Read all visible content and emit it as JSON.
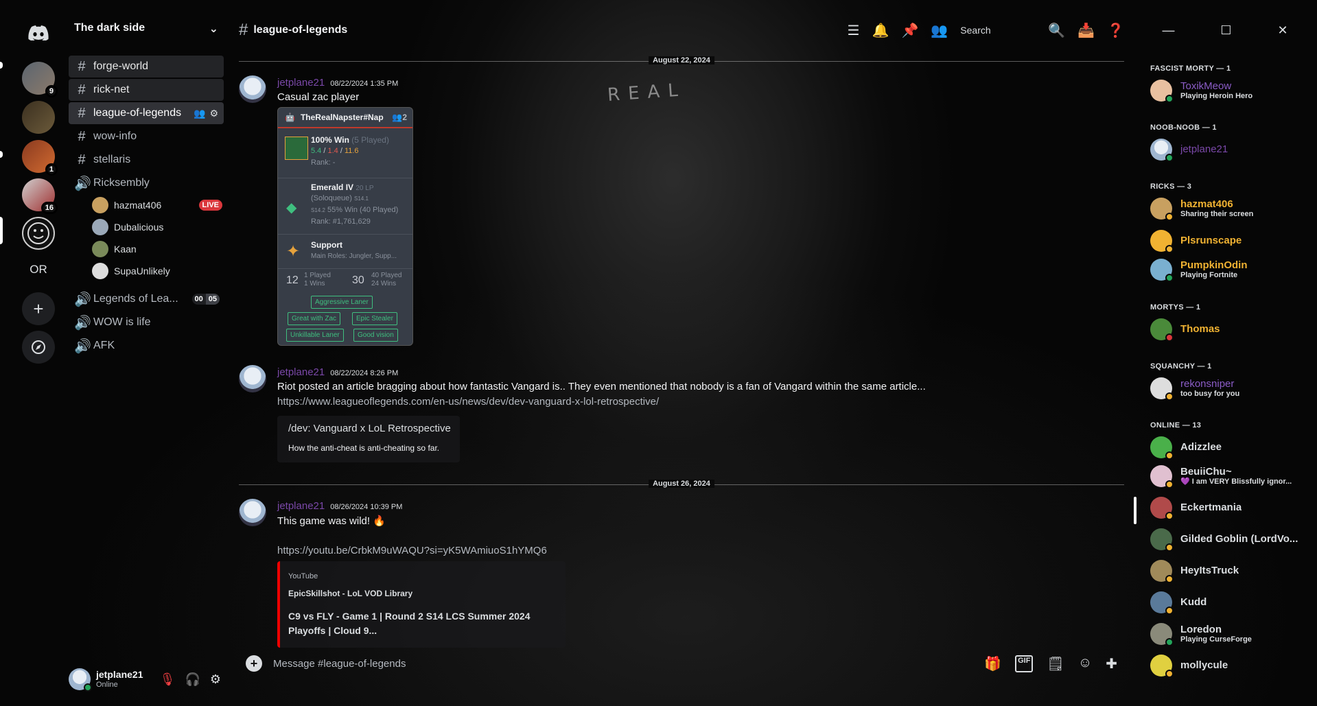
{
  "server": {
    "name": "The dark side",
    "rail_label": "OR",
    "badges": [
      "9",
      "1",
      "16"
    ]
  },
  "channels": [
    {
      "name": "forge-world",
      "type": "text"
    },
    {
      "name": "rick-net",
      "type": "text"
    },
    {
      "name": "league-of-legends",
      "type": "text"
    },
    {
      "name": "wow-info",
      "type": "text"
    },
    {
      "name": "stellaris",
      "type": "text"
    },
    {
      "name": "Ricksembly",
      "type": "voice"
    },
    {
      "name": "Legends of Lea...",
      "type": "voice"
    },
    {
      "name": "WOW is life",
      "type": "voice"
    },
    {
      "name": "AFK",
      "type": "voice"
    }
  ],
  "voice_users": [
    {
      "name": "hazmat406",
      "badge": "LIVE"
    },
    {
      "name": "Dubalicious"
    },
    {
      "name": "Kaan"
    },
    {
      "name": "SupaUnlikely"
    }
  ],
  "voice_count": [
    "00",
    "05"
  ],
  "user_panel": {
    "name": "jetplane21",
    "status": "Online"
  },
  "header": {
    "channel": "league-of-legends",
    "search_placeholder": "Search"
  },
  "composer": {
    "placeholder": "Message #league-of-legends"
  },
  "dates": [
    "August 22, 2024",
    "August 26, 2024"
  ],
  "messages": [
    {
      "author": "jetplane21",
      "time": "08/22/2024 1:35 PM",
      "text": "Casual zac player"
    },
    {
      "author": "jetplane21",
      "time": "08/22/2024 8:26 PM",
      "text": "Riot posted an article bragging about how fantastic Vangard is.. They even mentioned that nobody is a fan of Vangard within the same article...",
      "link": "https://www.leagueoflegends.com/en-us/news/dev/dev-vanguard-x-lol-retrospective/"
    },
    {
      "author": "jetplane21",
      "time": "08/26/2024 10:39 PM",
      "text": "This game was wild! 🔥",
      "link": "https://youtu.be/CrbkM9uWAQU?si=yK5WAmiuoS1hYMQ6"
    }
  ],
  "lol_card": {
    "title": "TheRealNapster#Nap",
    "count": "2",
    "win": "100% Win",
    "played": "(5 Played)",
    "kda_k": "5.4",
    "kda_d": "1.4",
    "kda_a": "11.6",
    "rank_label": "Rank: -",
    "tier": "Emerald IV",
    "lp": "20 LP",
    "queue": "(Soloqueue)",
    "season_tag": "S14.1",
    "season_prev": "S14.2",
    "season_win": "55% Win (40 Played)",
    "ladder": "Rank: #1,761,629",
    "role": "Support",
    "main_roles": "Main Roles: Jungler, Supp...",
    "lvl1": "12",
    "lvl1_played": "1 Played",
    "lvl1_wins": "1 Wins",
    "lvl2": "30",
    "lvl2_played": "40 Played",
    "lvl2_wins": "24 Wins",
    "tags": [
      "Aggressive Laner",
      "Great with Zac",
      "Epic Stealer",
      "Unkillable Laner",
      "Good vision"
    ]
  },
  "article_embed": {
    "title": "/dev: Vanguard x LoL Retrospective",
    "desc": "How the anti-cheat is anti-cheating so far."
  },
  "yt_embed": {
    "provider": "YouTube",
    "author": "EpicSkillshot - LoL VOD Library",
    "title_line1": "C9 vs FLY - Game 1 | Round 2 S14 LCS Summer 2024",
    "title_line2": "Playoffs | Cloud 9..."
  },
  "members": {
    "groups": [
      {
        "label": "FASCIST MORTY — 1",
        "members": [
          {
            "name": "ToxikMeow",
            "sub": "Playing Heroin Hero",
            "color": "#8b5cc7",
            "dot": "#23a55a"
          }
        ]
      },
      {
        "label": "NOOB-NOOB — 1",
        "members": [
          {
            "name": "jetplane21",
            "sub": "",
            "color": "#7a48a8",
            "dot": "#23a55a"
          }
        ]
      },
      {
        "label": "RICKS — 3",
        "members": [
          {
            "name": "hazmat406",
            "sub": "Sharing their screen",
            "color": "#f0b232",
            "dot": "#f0b232"
          },
          {
            "name": "Plsrunscape",
            "sub": "",
            "color": "#f0b232",
            "dot": "#f0b232"
          },
          {
            "name": "PumpkinOdin",
            "sub": "Playing Fortnite",
            "color": "#f0b232",
            "dot": "#23a55a"
          }
        ]
      },
      {
        "label": "MORTYS — 1",
        "members": [
          {
            "name": "Thomas",
            "sub": "",
            "color": "#f0b232",
            "dot": "#da373c"
          }
        ]
      },
      {
        "label": "SQUANCHY — 1",
        "members": [
          {
            "name": "rekonsniper",
            "sub": "too busy for you",
            "color": "#8b5cc7",
            "dot": "#f0b232"
          }
        ]
      },
      {
        "label": "ONLINE — 13",
        "members": [
          {
            "name": "Adizzlee",
            "sub": "",
            "color": "#f2f3f5",
            "dot": "#f0b232"
          },
          {
            "name": "BeuiiChu~",
            "sub": "💜 I am VERY Blissfully ignor...",
            "color": "#f2f3f5",
            "dot": "#f0b232"
          },
          {
            "name": "Eckertmania",
            "sub": "",
            "color": "#f2f3f5",
            "dot": "#f0b232"
          },
          {
            "name": "Gilded Goblin (LordVo...",
            "sub": "",
            "color": "#f2f3f5",
            "dot": "#f0b232"
          },
          {
            "name": "HeyItsTruck",
            "sub": "",
            "color": "#f2f3f5",
            "dot": "#f0b232"
          },
          {
            "name": "Kudd",
            "sub": "",
            "color": "#f2f3f5",
            "dot": "#f0b232"
          },
          {
            "name": "Loredon",
            "sub": "Playing CurseForge",
            "color": "#f2f3f5",
            "dot": "#23a55a"
          },
          {
            "name": "mollycule",
            "sub": "",
            "color": "#f2f3f5",
            "dot": "#f0b232"
          }
        ]
      }
    ]
  }
}
